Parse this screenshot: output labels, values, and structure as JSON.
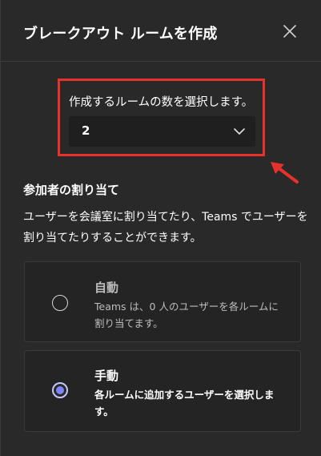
{
  "header": {
    "title": "ブレークアウト ルームを作成"
  },
  "room_count": {
    "label": "作成するルームの数を選択します。",
    "value": "2"
  },
  "assignment": {
    "title": "参加者の割り当て",
    "description": "ユーザーを会議室に割り当てたり、Teams でユーザーを割り当てたりすることができます。",
    "options": [
      {
        "title": "自動",
        "description": "Teams は、0 人のユーザーを各ルームに割り当てます。",
        "selected": false
      },
      {
        "title": "手動",
        "description": "各ルームに追加するユーザーを選択します。",
        "selected": true
      }
    ]
  },
  "colors": {
    "background": "#292929",
    "annotation": "#e8312a",
    "radio_accent": "#7f85f5"
  },
  "icons": {
    "close": "close-icon",
    "chevron": "chevron-down-icon",
    "annotation_arrow": "arrow-icon"
  }
}
